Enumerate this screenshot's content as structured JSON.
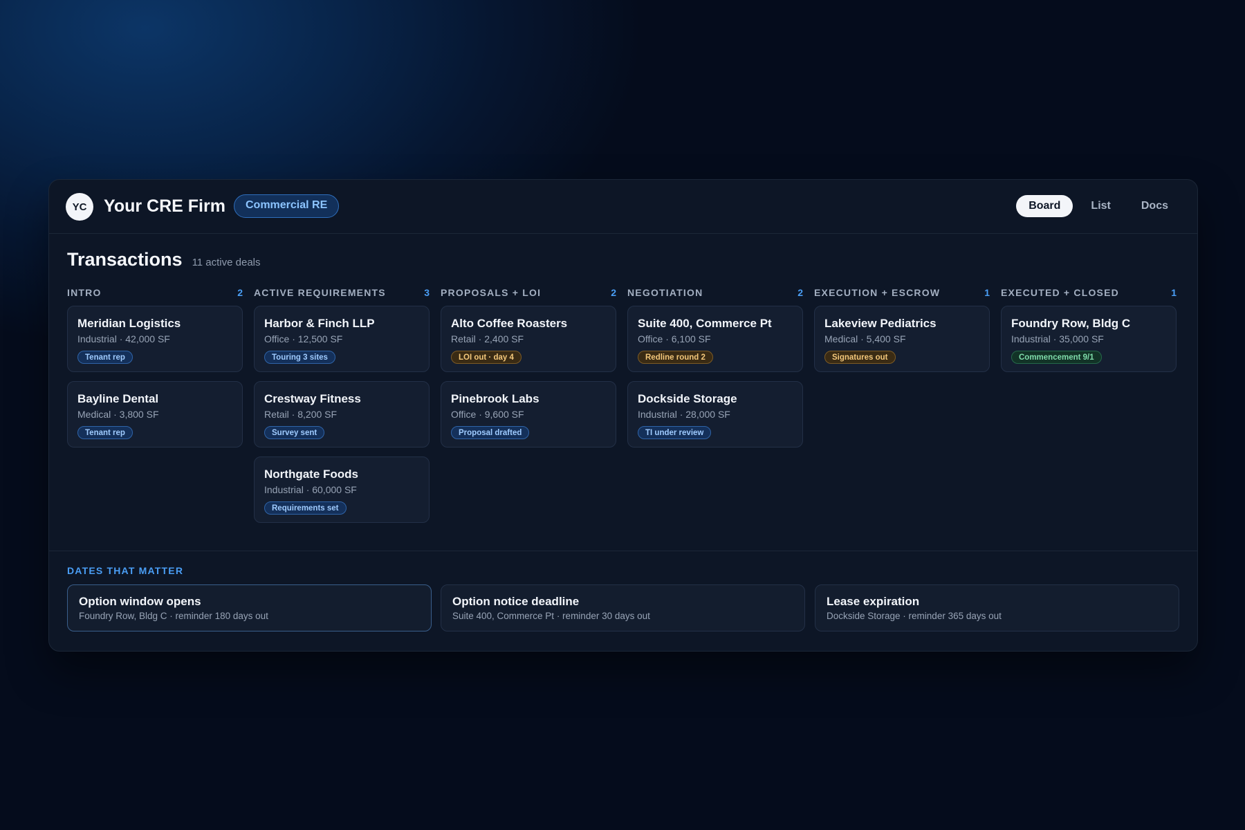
{
  "header": {
    "avatar_initials": "YC",
    "firm_name": "Your CRE Firm",
    "tag": "Commercial RE",
    "views": [
      "Board",
      "List",
      "Docs"
    ],
    "active_view": "Board"
  },
  "board": {
    "title": "Transactions",
    "subtitle": "11 active deals",
    "columns": [
      {
        "name": "INTRO",
        "count": "2",
        "cards": [
          {
            "name": "Meridian Logistics",
            "meta": "Industrial · 42,000 SF",
            "badge": "Tenant rep",
            "badge_color": "blue"
          },
          {
            "name": "Bayline Dental",
            "meta": "Medical · 3,800 SF",
            "badge": "Tenant rep",
            "badge_color": "blue"
          }
        ]
      },
      {
        "name": "ACTIVE REQUIREMENTS",
        "count": "3",
        "cards": [
          {
            "name": "Harbor & Finch LLP",
            "meta": "Office · 12,500 SF",
            "badge": "Touring 3 sites",
            "badge_color": "blue"
          },
          {
            "name": "Crestway Fitness",
            "meta": "Retail · 8,200 SF",
            "badge": "Survey sent",
            "badge_color": "blue"
          },
          {
            "name": "Northgate Foods",
            "meta": "Industrial · 60,000 SF",
            "badge": "Requirements set",
            "badge_color": "blue"
          }
        ]
      },
      {
        "name": "PROPOSALS + LOI",
        "count": "2",
        "cards": [
          {
            "name": "Alto Coffee Roasters",
            "meta": "Retail · 2,400 SF",
            "badge": "LOI out · day 4",
            "badge_color": "amber"
          },
          {
            "name": "Pinebrook Labs",
            "meta": "Office · 9,600 SF",
            "badge": "Proposal drafted",
            "badge_color": "blue"
          }
        ]
      },
      {
        "name": "NEGOTIATION",
        "count": "2",
        "cards": [
          {
            "name": "Suite 400, Commerce Pt",
            "meta": "Office · 6,100 SF",
            "badge": "Redline round 2",
            "badge_color": "amber"
          },
          {
            "name": "Dockside Storage",
            "meta": "Industrial · 28,000 SF",
            "badge": "TI under review",
            "badge_color": "blue"
          }
        ]
      },
      {
        "name": "EXECUTION + ESCROW",
        "count": "1",
        "cards": [
          {
            "name": "Lakeview Pediatrics",
            "meta": "Medical · 5,400 SF",
            "badge": "Signatures out",
            "badge_color": "amber"
          }
        ]
      },
      {
        "name": "EXECUTED + CLOSED",
        "count": "1",
        "cards": [
          {
            "name": "Foundry Row, Bldg C",
            "meta": "Industrial · 35,000 SF",
            "badge": "Commencement 9/1",
            "badge_color": "green"
          }
        ]
      }
    ]
  },
  "dates": {
    "title": "DATES THAT MATTER",
    "items": [
      {
        "title": "Option window opens",
        "sub": "Foundry Row, Bldg C · reminder 180 days out"
      },
      {
        "title": "Option notice deadline",
        "sub": "Suite 400, Commerce Pt · reminder 30 days out"
      },
      {
        "title": "Lease expiration",
        "sub": "Dockside Storage · reminder 365 days out"
      }
    ]
  }
}
